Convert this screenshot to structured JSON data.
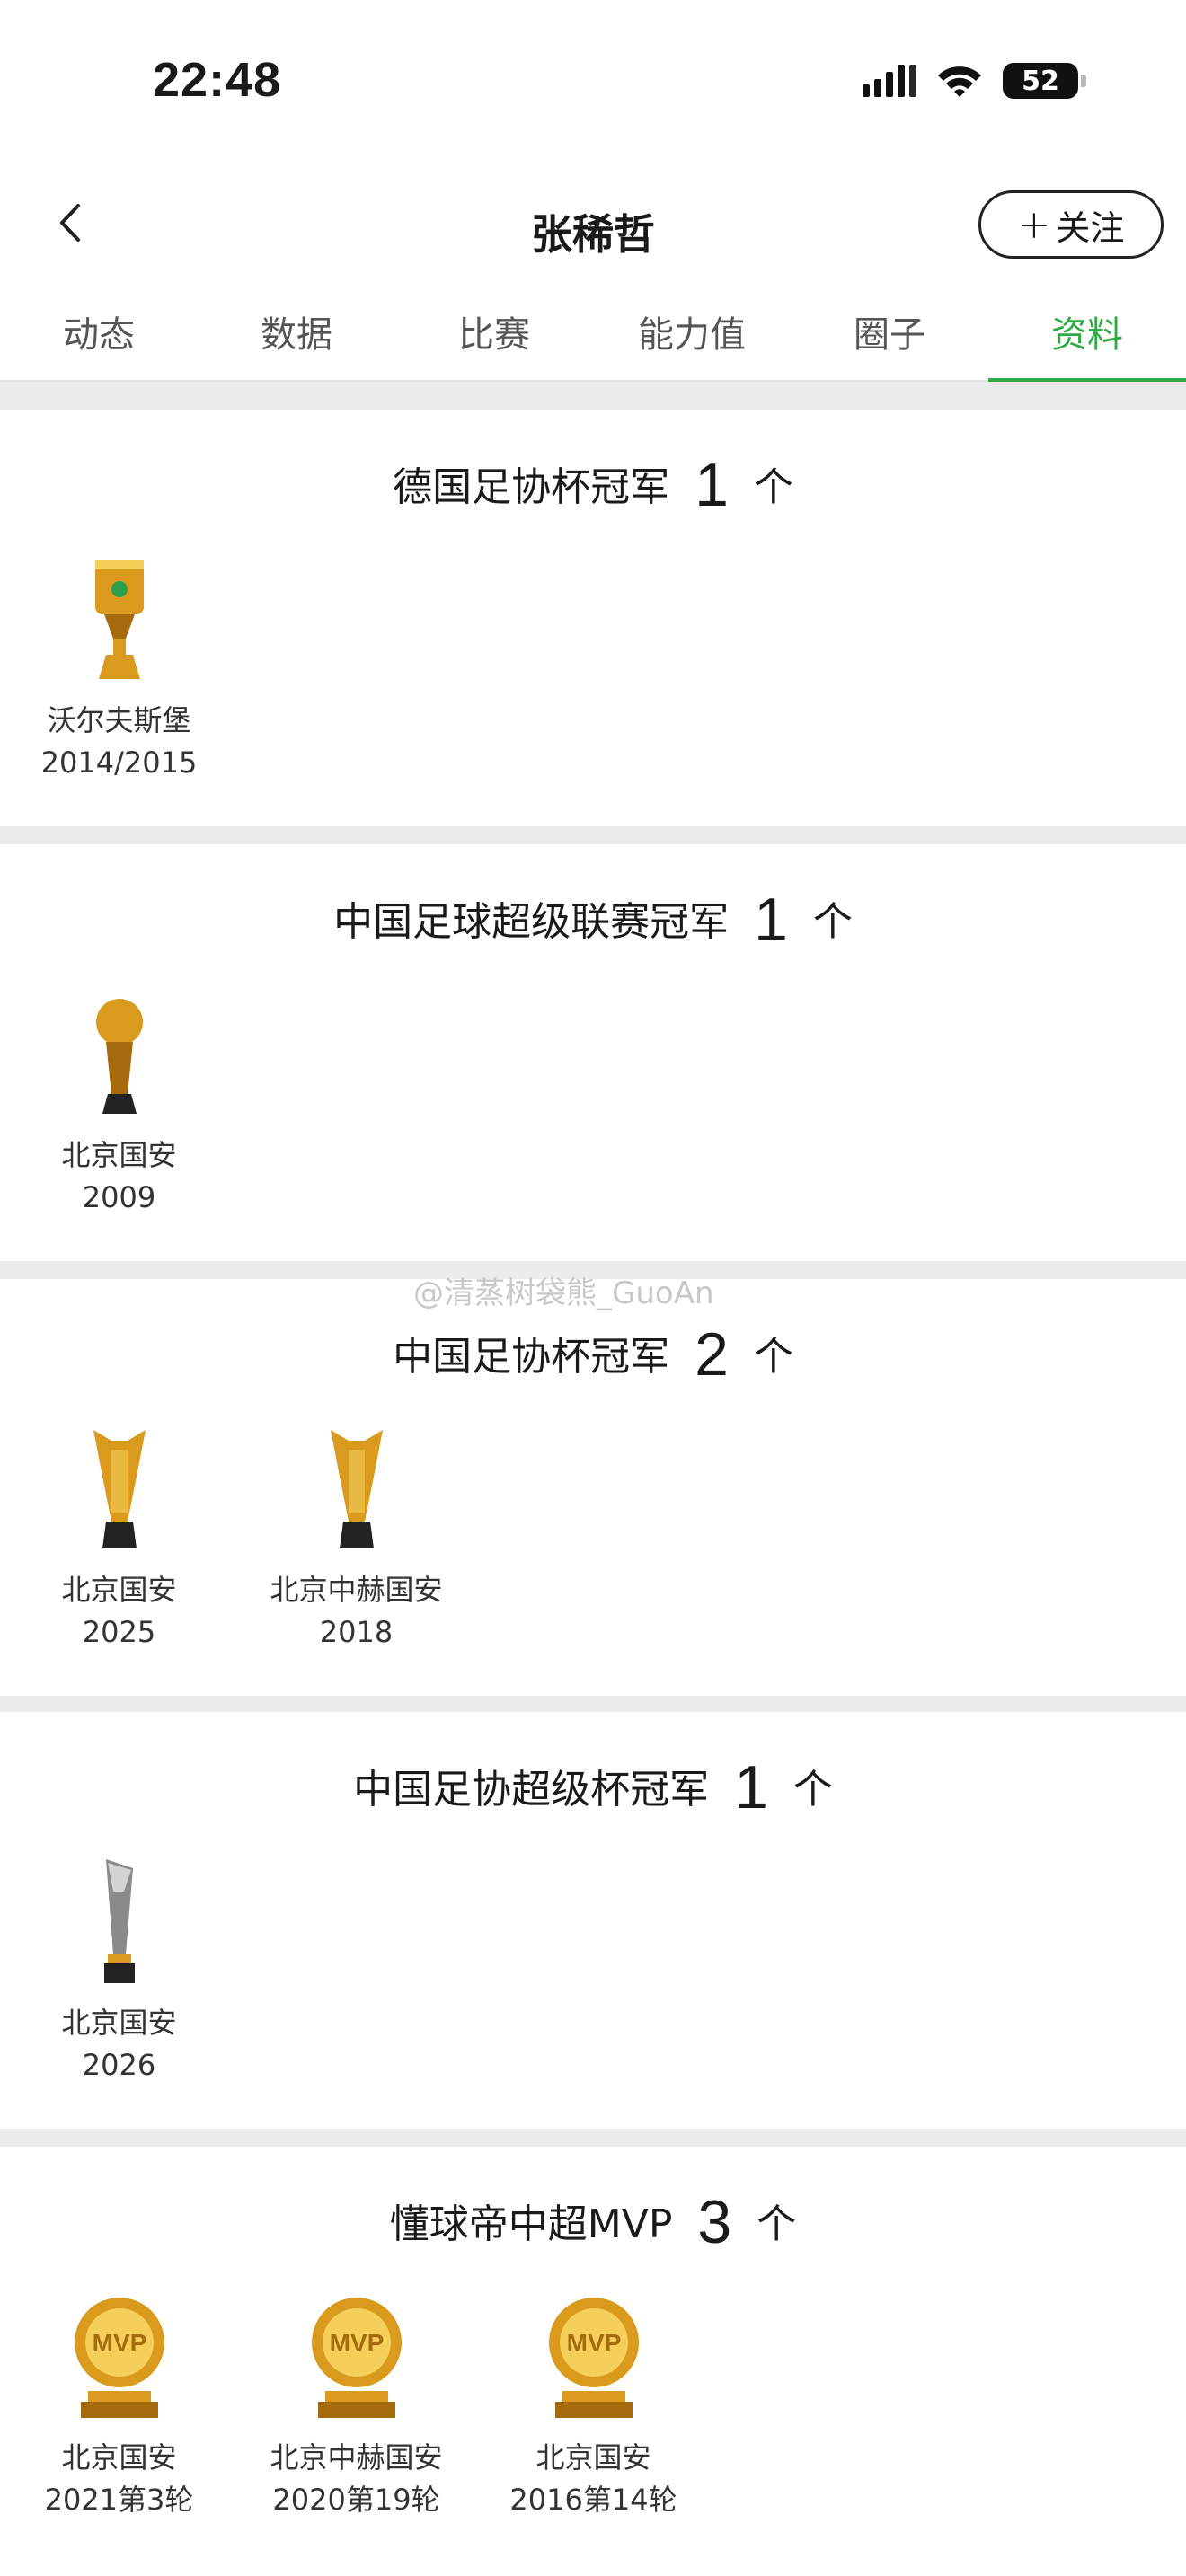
{
  "status_bar": {
    "time": "22:48",
    "battery": "52"
  },
  "nav": {
    "title": "张稀哲",
    "follow_label": "关注",
    "follow_plus": "+"
  },
  "tabs": [
    {
      "label": "动态"
    },
    {
      "label": "数据"
    },
    {
      "label": "比赛"
    },
    {
      "label": "能力值"
    },
    {
      "label": "圈子"
    },
    {
      "label": "资料",
      "active": true
    }
  ],
  "accent_color": "#2faa44",
  "watermark": "@清蒸树袋熊_GuoAn",
  "sections": [
    {
      "title": "德国足协杯冠军",
      "count": "1",
      "unit": "个",
      "trophies": [
        {
          "team": "沃尔夫斯堡",
          "year": "2014/2015",
          "icon": "dfb-pokal-trophy-icon"
        }
      ]
    },
    {
      "title": "中国足球超级联赛冠军",
      "count": "1",
      "unit": "个",
      "trophies": [
        {
          "team": "北京国安",
          "year": "2009",
          "icon": "csl-trophy-icon"
        }
      ]
    },
    {
      "title": "中国足协杯冠军",
      "count": "2",
      "unit": "个",
      "trophies": [
        {
          "team": "北京国安",
          "year": "2025",
          "icon": "fa-cup-trophy-icon"
        },
        {
          "team": "北京中赫国安",
          "year": "2018",
          "icon": "fa-cup-trophy-icon"
        }
      ]
    },
    {
      "title": "中国足协超级杯冠军",
      "count": "1",
      "unit": "个",
      "trophies": [
        {
          "team": "北京国安",
          "year": "2026",
          "icon": "super-cup-trophy-icon"
        }
      ]
    },
    {
      "title": "懂球帝中超MVP",
      "count": "3",
      "unit": "个",
      "trophies": [
        {
          "team": "北京国安",
          "year": "2021第3轮",
          "icon": "mvp-trophy-icon"
        },
        {
          "team": "北京中赫国安",
          "year": "2020第19轮",
          "icon": "mvp-trophy-icon"
        },
        {
          "team": "北京国安",
          "year": "2016第14轮",
          "icon": "mvp-trophy-icon"
        }
      ]
    }
  ]
}
